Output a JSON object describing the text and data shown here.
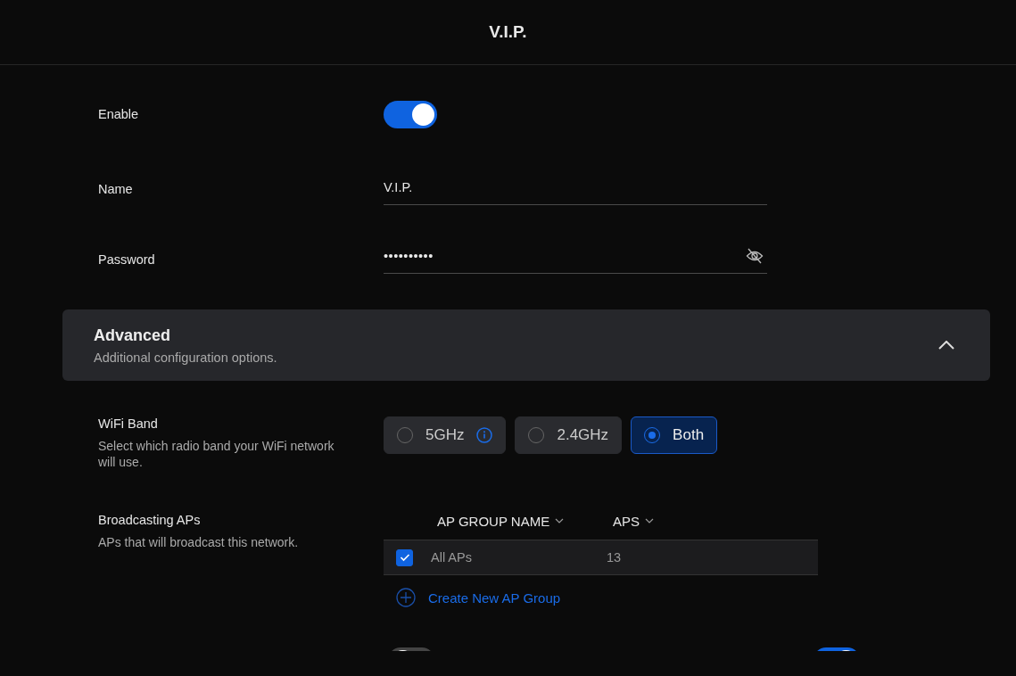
{
  "header": {
    "title": "V.I.P."
  },
  "enable": {
    "label": "Enable",
    "on": true
  },
  "name": {
    "label": "Name",
    "value": "V.I.P."
  },
  "password": {
    "label": "Password",
    "value": "••••••••••"
  },
  "advanced": {
    "title": "Advanced",
    "subtitle": "Additional configuration options.",
    "expanded": true
  },
  "wifi_band": {
    "label": "WiFi Band",
    "description": "Select which radio band your WiFi network will use.",
    "options": [
      {
        "label": "5GHz",
        "selected": false,
        "info": true
      },
      {
        "label": "2.4GHz",
        "selected": false,
        "info": false
      },
      {
        "label": "Both",
        "selected": true,
        "info": false
      }
    ]
  },
  "broadcasting_aps": {
    "label": "Broadcasting APs",
    "description": "APs that will broadcast this network.",
    "columns": [
      "AP GROUP NAME",
      "APS"
    ],
    "rows": [
      {
        "name": "All APs",
        "aps": "13",
        "checked": true
      }
    ],
    "create_link": "Create New AP Group"
  },
  "partial_toggles": [
    {
      "on": false
    },
    {
      "on": true
    }
  ]
}
